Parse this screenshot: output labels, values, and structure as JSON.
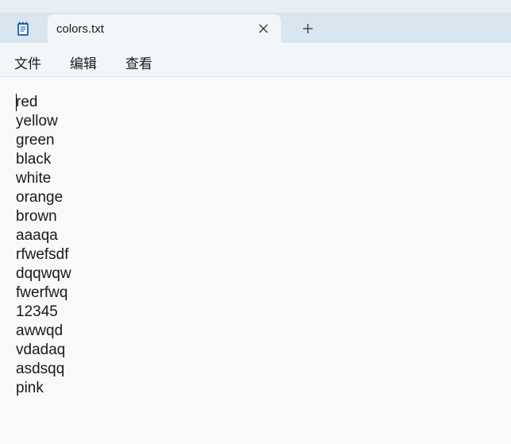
{
  "tab": {
    "title": "colors.txt"
  },
  "menu": {
    "items": [
      {
        "label": "文件"
      },
      {
        "label": "编辑"
      },
      {
        "label": "查看"
      }
    ]
  },
  "editor": {
    "lines": [
      "red",
      "yellow",
      "green",
      "black",
      "white",
      "orange",
      "brown",
      "aaaqa",
      "rfwefsdf",
      "dqqwqw",
      "fwerfwq",
      "12345",
      "awwqd",
      "vdadaq",
      "asdsqq",
      "pink"
    ]
  },
  "icons": {
    "app": "notepad-icon",
    "close": "close-icon",
    "new_tab": "plus-icon"
  },
  "colors": {
    "titlebar": "#d9e5ef",
    "tab": "#f3f6f9",
    "editor_bg": "#f9f9f9",
    "text": "#1a1a1a",
    "app_icon_accent": "#2b6cb0"
  }
}
